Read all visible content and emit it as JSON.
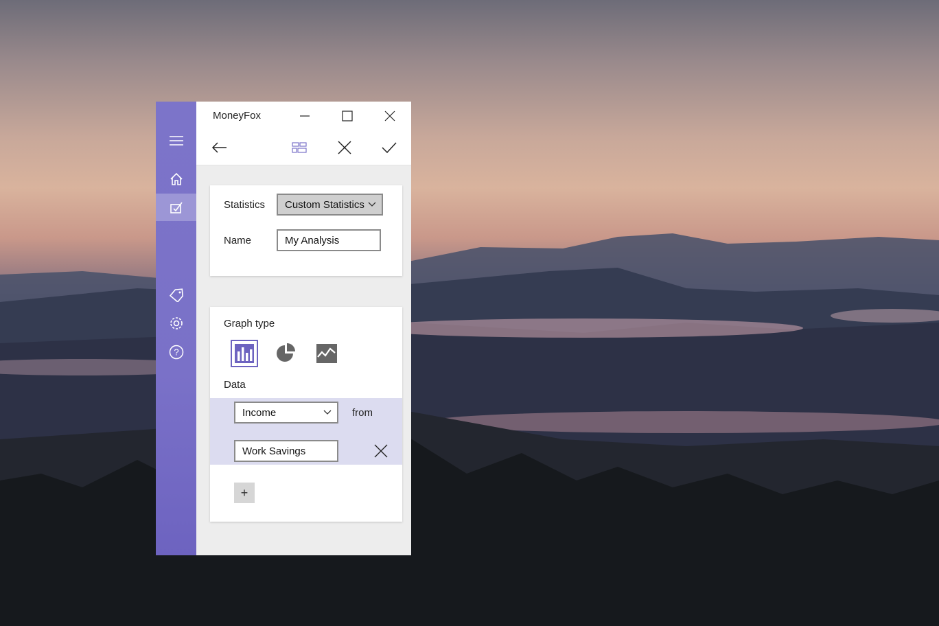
{
  "window": {
    "title": "MoneyFox"
  },
  "nav": {
    "items": [
      {
        "name": "hamburger-menu-icon"
      },
      {
        "name": "home-icon"
      },
      {
        "name": "statistics-icon",
        "selected": true
      },
      {
        "name": "tag-icon"
      },
      {
        "name": "gear-icon"
      },
      {
        "name": "help-icon"
      }
    ]
  },
  "form": {
    "statistics_label": "Statistics",
    "statistics_value": "Custom Statistics",
    "name_label": "Name",
    "name_value": "My Analysis",
    "graph_type_label": "Graph type",
    "graph_types": [
      "bar-chart",
      "pie-chart",
      "line-chart"
    ],
    "graph_selected": "bar-chart",
    "data_label": "Data",
    "data_row": {
      "category": "Income",
      "from_label": "from",
      "account": "Work Savings"
    },
    "add_label": "+"
  },
  "colors": {
    "accent": "#7a71c8",
    "selected_row": "#dcdcf0"
  }
}
